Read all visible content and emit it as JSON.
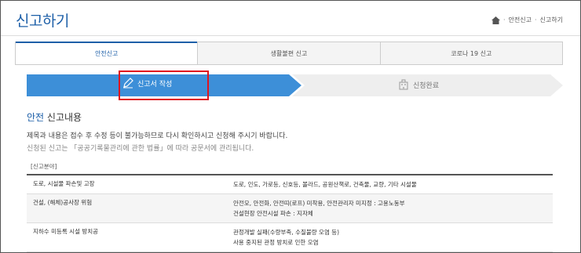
{
  "page": {
    "title": "신고하기"
  },
  "breadcrumb": [
    "안전신고",
    "신고하기"
  ],
  "tabs": [
    {
      "label": "안전신고",
      "active": true
    },
    {
      "label": "생활불편 신고",
      "active": false
    },
    {
      "label": "코로나 19 신고",
      "active": false
    }
  ],
  "steps": [
    {
      "label": "신고서 작성",
      "icon": "pencil-icon",
      "active": true
    },
    {
      "label": "신청완료",
      "icon": "building-icon",
      "active": false
    }
  ],
  "section": {
    "title_accent": "안전",
    "title_rest": " 신고내용"
  },
  "notice": {
    "line1": "제목과 내용은 접수 후 수정 등이 불가능하므로 다시 확인하시고 신청해 주시기 바랍니다.",
    "line2": "신청된 신고는 「공공기록물관리에 관한 법률」에 따라 공문서에 관리됩니다."
  },
  "category_label": "[신고분야]",
  "table": {
    "rows": [
      {
        "name": "도로, 시설물 파손및 고장",
        "desc": [
          "도로, 인도, 가로등, 신호등, 볼라드, 공원산책로, 건축물, 교량, 기타 시설물"
        ]
      },
      {
        "name": "건설, (해체)공사장 위험",
        "desc": [
          "안전모, 안전화, 안전띠(로프) 미착용, 안전관리자 미지정 : 고용노동부",
          "건설현장 안전시설 파손 : 지자체"
        ]
      },
      {
        "name": "지하수 미등록 시설 방치공",
        "desc": [
          "관정개발 실패(수량부족, 수질불량 오염 등)",
          "사용 중지된 관정 방치로 인한 오염"
        ]
      }
    ]
  },
  "colors": {
    "brand": "#1d5fa8",
    "step_active": "#3d8fd8",
    "highlight": "#e0141e"
  }
}
